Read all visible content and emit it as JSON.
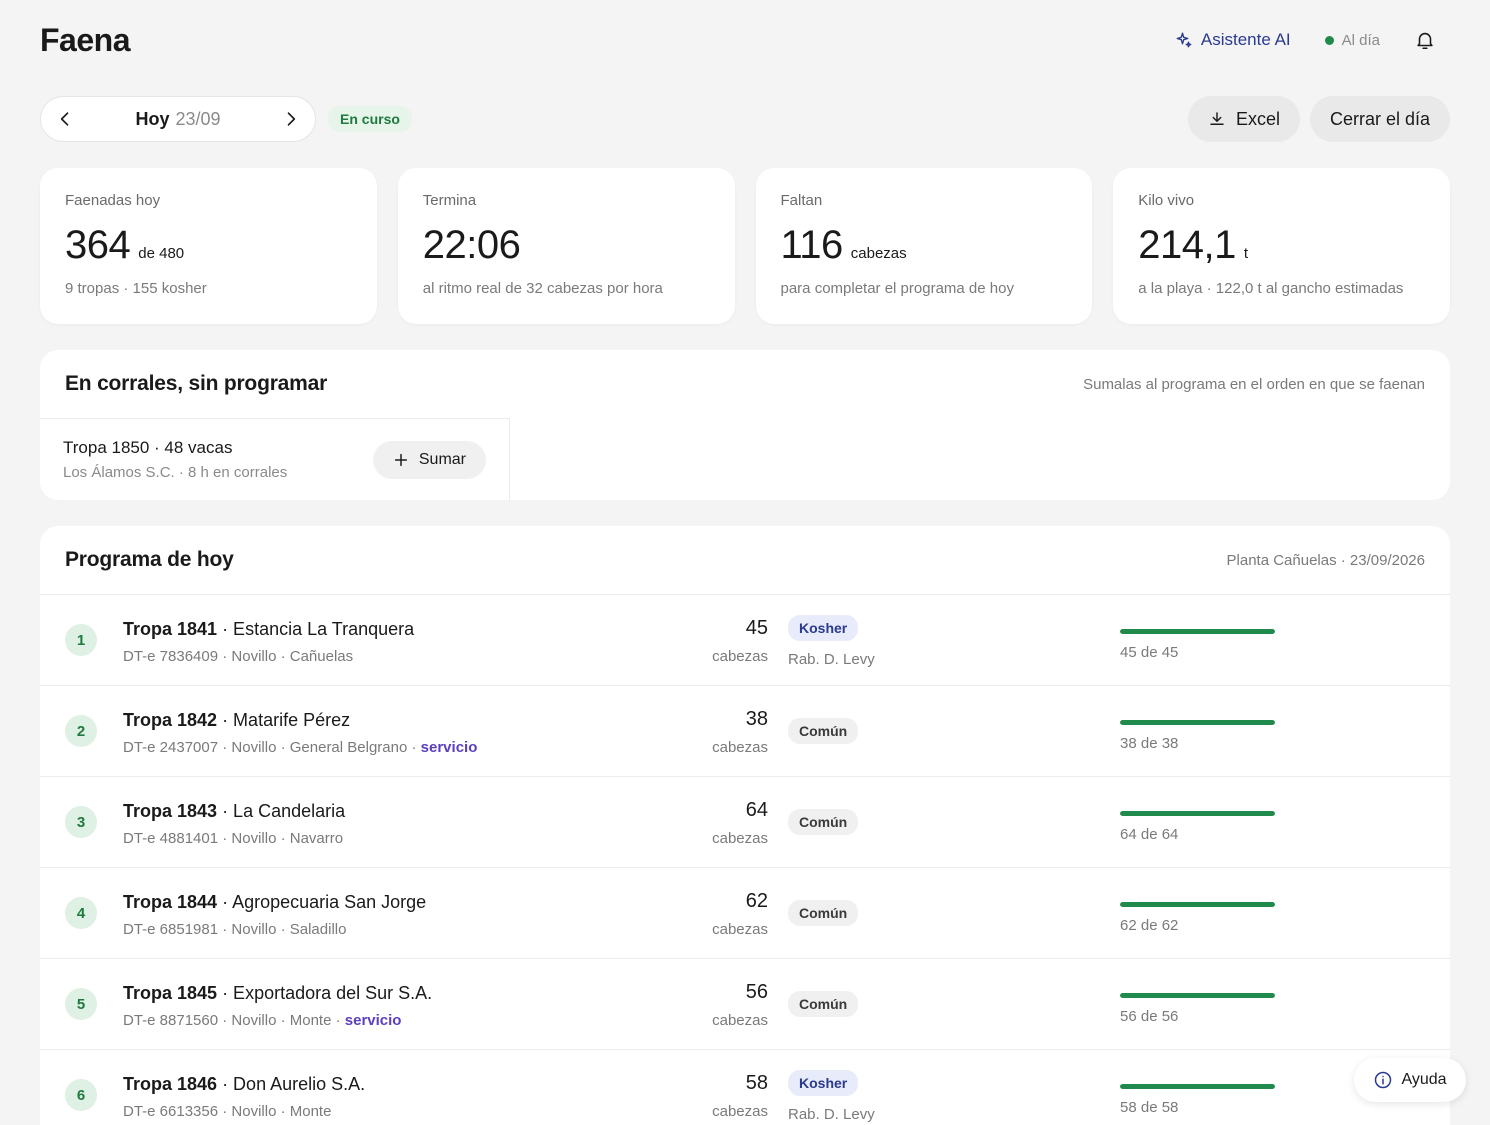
{
  "app": {
    "title": "Faena"
  },
  "header": {
    "ai_label": "Asistente AI",
    "status_label": "Al día"
  },
  "date": {
    "day": "Hoy",
    "num": "23/09",
    "badge": "En curso",
    "excel_label": "Excel",
    "close_label": "Cerrar el día"
  },
  "kpis": [
    {
      "label": "Faenadas hoy",
      "value": "364",
      "unit": "de 480",
      "sub": "9 tropas · 155 kosher"
    },
    {
      "label": "Termina",
      "value": "22:06",
      "unit": "",
      "sub": "al ritmo real de 32 cabezas por hora"
    },
    {
      "label": "Faltan",
      "value": "116",
      "unit": "cabezas",
      "sub": "para completar el programa de hoy"
    },
    {
      "label": "Kilo vivo",
      "value": "214,1",
      "unit": "t",
      "sub": "a la playa · 122,0 t al gancho estimadas"
    }
  ],
  "corrales": {
    "title": "En corrales, sin programar",
    "note": "Sumalas al programa en el orden en que se faenan",
    "pending": {
      "title": "Tropa 1850 · 48 vacas",
      "sub": "Los Álamos S.C. · 8 h en corrales",
      "add_label": "Sumar"
    }
  },
  "programa": {
    "title": "Programa de hoy",
    "plant": "Planta Cañuelas · 23/09/2026",
    "rows": [
      {
        "idx": "1",
        "tropa": "Tropa 1841",
        "owner": " · Estancia La Tranquera",
        "meta": "DT-e 7836409 · Novillo · Cañuelas",
        "service": "",
        "qty": "45",
        "unit": "cabezas",
        "type": "Kosher",
        "rabbi": "Rab. D. Levy",
        "done": 45,
        "total": 45,
        "progress_label": "45 de 45"
      },
      {
        "idx": "2",
        "tropa": "Tropa 1842",
        "owner": " · Matarife Pérez",
        "meta": "DT-e 2437007 · Novillo · General Belgrano · ",
        "service": "servicio",
        "qty": "38",
        "unit": "cabezas",
        "type": "Común",
        "rabbi": "",
        "done": 38,
        "total": 38,
        "progress_label": "38 de 38"
      },
      {
        "idx": "3",
        "tropa": "Tropa 1843",
        "owner": " · La Candelaria",
        "meta": "DT-e 4881401 · Novillo · Navarro",
        "service": "",
        "qty": "64",
        "unit": "cabezas",
        "type": "Común",
        "rabbi": "",
        "done": 64,
        "total": 64,
        "progress_label": "64 de 64"
      },
      {
        "idx": "4",
        "tropa": "Tropa 1844",
        "owner": " · Agropecuaria San Jorge",
        "meta": "DT-e 6851981 · Novillo · Saladillo",
        "service": "",
        "qty": "62",
        "unit": "cabezas",
        "type": "Común",
        "rabbi": "",
        "done": 62,
        "total": 62,
        "progress_label": "62 de 62"
      },
      {
        "idx": "5",
        "tropa": "Tropa 1845",
        "owner": " · Exportadora del Sur S.A.",
        "meta": "DT-e 8871560 · Novillo · Monte · ",
        "service": "servicio",
        "qty": "56",
        "unit": "cabezas",
        "type": "Común",
        "rabbi": "",
        "done": 56,
        "total": 56,
        "progress_label": "56 de 56"
      },
      {
        "idx": "6",
        "tropa": "Tropa 1846",
        "owner": " · Don Aurelio S.A.",
        "meta": "DT-e 6613356 · Novillo · Monte",
        "service": "",
        "qty": "58",
        "unit": "cabezas",
        "type": "Kosher",
        "rabbi": "Rab. D. Levy",
        "done": 58,
        "total": 58,
        "progress_label": "58 de 58"
      }
    ]
  },
  "help": {
    "label": "Ayuda"
  },
  "icons": {
    "ai": "sparkle-icon",
    "bell": "bell-icon",
    "prev": "chevron-left-icon",
    "next": "chevron-right-icon",
    "download": "download-icon",
    "plus": "plus-icon",
    "info": "info-icon"
  },
  "colors": {
    "accent": "#2a3a8f",
    "success": "#1f8a4c",
    "service": "#5b3fbf"
  }
}
